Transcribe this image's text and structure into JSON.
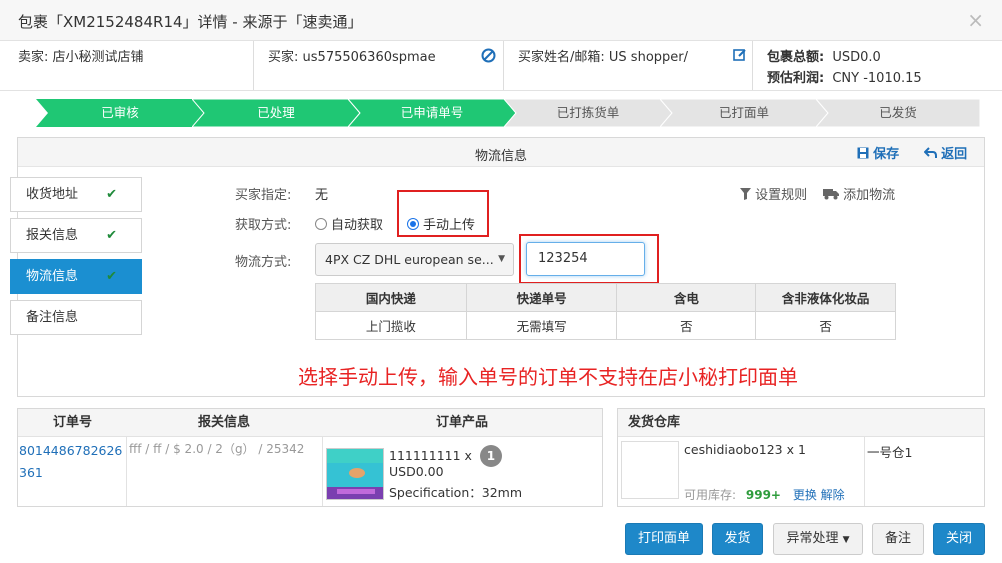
{
  "dialog": {
    "title": "包裹「XM2152484R14」详情 - 来源于「速卖通」",
    "close_symbol": "×"
  },
  "info": {
    "seller_label": "卖家:",
    "seller_value": "店小秘测试店铺",
    "buyer_label": "买家:",
    "buyer_value": "us575506360spmae",
    "buyer_name_label": "买家姓名/邮箱:",
    "buyer_name_value": "US shopper/",
    "total_label": "包裹总额:",
    "total_value": "USD0.0",
    "profit_label": "预估利润:",
    "profit_value": "CNY -1010.15"
  },
  "steps": [
    {
      "label": "已审核",
      "done": true
    },
    {
      "label": "已处理",
      "done": true
    },
    {
      "label": "已申请单号",
      "done": true
    },
    {
      "label": "已打拣货单",
      "done": false
    },
    {
      "label": "已打面单",
      "done": false
    },
    {
      "label": "已发货",
      "done": false
    }
  ],
  "panel": {
    "title": "物流信息",
    "save": "保存",
    "back": "返回"
  },
  "tabs": [
    {
      "label": "收货地址",
      "check": "✔"
    },
    {
      "label": "报关信息",
      "check": "✔"
    },
    {
      "label": "物流信息",
      "check": "✔"
    },
    {
      "label": "备注信息",
      "check": ""
    }
  ],
  "form": {
    "buyer_assign_label": "买家指定:",
    "buyer_assign_value": "无",
    "method_label": "获取方式:",
    "method_auto": "自动获取",
    "method_manual": "手动上传",
    "logistics_label": "物流方式:",
    "logistics_value": "4PX CZ DHL european se...",
    "tracking_value": "123254",
    "rule_link": "设置规则",
    "add_link": "添加物流"
  },
  "logistics_table": {
    "headers": [
      "国内快递",
      "快递单号",
      "含电",
      "含非液体化妆品"
    ],
    "row": [
      "上门揽收",
      "无需填写",
      "否",
      "否"
    ]
  },
  "warning": "选择手动上传，输入单号的订单不支持在店小秘打印面单",
  "orders": {
    "headers": [
      "订单号",
      "报关信息",
      "订单产品"
    ],
    "order_no": "8014486782626361",
    "customs": "fff / ff / $ 2.0 / 2（g） / 25342",
    "product_sku": "111111111 x",
    "product_qty": "1",
    "product_price": "USD0.00",
    "product_spec": "Specification：32mm"
  },
  "warehouse": {
    "header": "发货仓库",
    "item": "ceshidiaobo123 x 1",
    "stock_label": "可用库存:",
    "stock_value": "999+",
    "swap": "更换",
    "unbind": "解除",
    "name": "一号仓1"
  },
  "buttons": {
    "print": "打印面单",
    "ship": "发货",
    "exception": "异常处理",
    "note": "备注",
    "close": "关闭"
  },
  "colors": {
    "step_done": "#1fc774",
    "step_todo": "#e4e4e4",
    "primary": "#1e88c9",
    "warning": "#e82323"
  }
}
